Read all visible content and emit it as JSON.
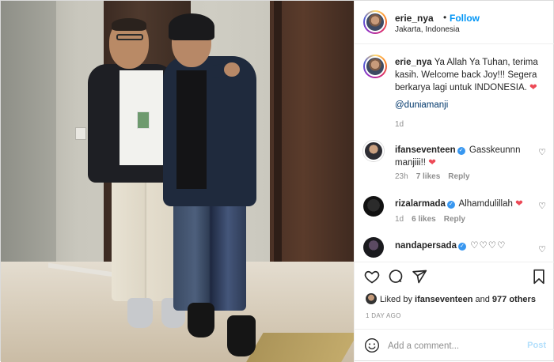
{
  "post": {
    "username": "erie_nya",
    "follow_label": "Follow",
    "location": "Jakarta, Indonesia",
    "caption": {
      "username": "erie_nya",
      "text": "Ya Allah Ya Tuhan, terima kasih. Welcome back Joy!!! Segera berkarya lagi untuk INDONESIA.",
      "mention": "@duniamanji",
      "time": "1d"
    },
    "comments": [
      {
        "username": "ifanseventeen",
        "text": "Gasskeunnn manjiii!!",
        "time": "23h",
        "likes": "7 likes",
        "reply": "Reply"
      },
      {
        "username": "rizalarmada",
        "text": "Alhamdulillah",
        "time": "1d",
        "likes": "6 likes",
        "reply": "Reply"
      },
      {
        "username": "nandapersada",
        "text": "♡♡♡♡",
        "time": "",
        "likes": "",
        "reply": ""
      }
    ],
    "liked_by": {
      "prefix": "Liked by",
      "user": "ifanseventeen",
      "and": "and",
      "others": "977 others"
    },
    "posted_ago": "1 DAY AGO",
    "add_comment_placeholder": "Add a comment...",
    "post_button": "Post"
  },
  "colors": {
    "accent": "#0095f6",
    "heart": "#ed4956",
    "verified": "#3897f0",
    "muted": "#8e8e8e"
  },
  "icons": [
    "heart-icon",
    "comment-icon",
    "share-icon",
    "bookmark-icon",
    "emoji-icon",
    "verified-badge-icon"
  ]
}
